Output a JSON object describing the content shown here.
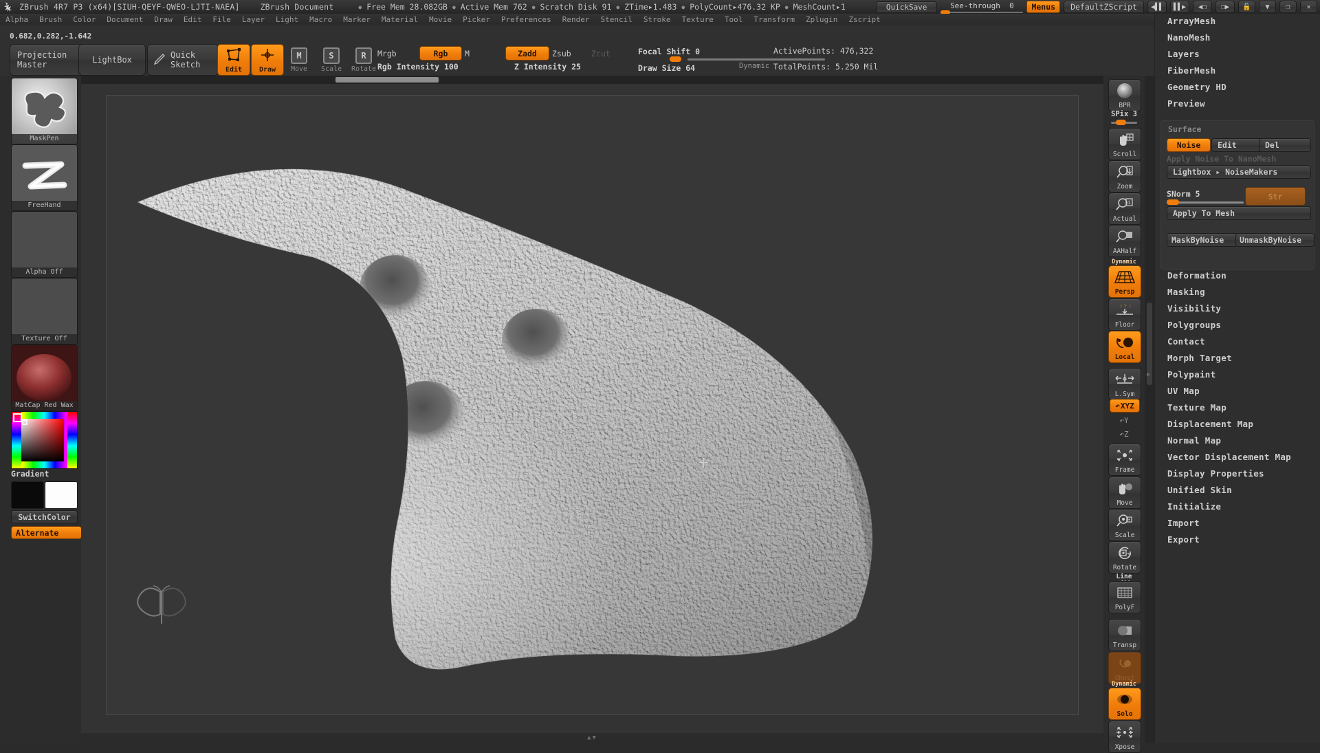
{
  "titlebar": {
    "app_title": "ZBrush 4R7 P3 (x64)[SIUH-QEYF-QWEO-LJTI-NAEA]",
    "document_title": "ZBrush Document",
    "stats": [
      "Free Mem 28.082GB",
      "Active Mem 762",
      "Scratch Disk 91",
      "ZTime▸1.483",
      "PolyCount▸476.32 KP",
      "MeshCount▸1"
    ],
    "quicksave": "QuickSave",
    "seethrough_label": "See-through",
    "seethrough_value": "0",
    "menus_button": "Menus",
    "zscript": "DefaultZScript",
    "icons": [
      "prev-script-icon",
      "next-script-icon",
      "prev-doc-icon",
      "next-doc-icon",
      "lock-icon",
      "minimize-icon",
      "restore-icon",
      "close-icon"
    ]
  },
  "menubar": {
    "items": [
      "Alpha",
      "Brush",
      "Color",
      "Document",
      "Draw",
      "Edit",
      "File",
      "Layer",
      "Light",
      "Macro",
      "Marker",
      "Material",
      "Movie",
      "Picker",
      "Preferences",
      "Render",
      "Stencil",
      "Stroke",
      "Texture",
      "Tool",
      "Transform",
      "Zplugin",
      "Zscript"
    ]
  },
  "toolbar": {
    "coords": "0.682,0.282,-1.642",
    "projection_master": "Projection\nMaster",
    "projection_master_l1": "Projection",
    "projection_master_l2": "Master",
    "lightbox": "LightBox",
    "quick_sketch_l1": "Quick",
    "quick_sketch_l2": "Sketch",
    "edit": "Edit",
    "draw": "Draw",
    "move": "Move",
    "scale": "Scale",
    "rotate": "Rotate",
    "move_key": "M",
    "scale_key": "S",
    "rotate_key": "R",
    "mrgb": "Mrgb",
    "rgb": "Rgb",
    "m": "M",
    "rgb_intensity": "Rgb Intensity 100",
    "zadd": "Zadd",
    "zsub": "Zsub",
    "zcut": "Zcut",
    "z_intensity": "Z Intensity 25",
    "focal_shift": "Focal Shift 0",
    "draw_size": "Draw Size 64",
    "dynamic": "Dynamic",
    "active_points": "ActivePoints: 476,322",
    "total_points": "TotalPoints: 5.250 Mil"
  },
  "left_shelf": {
    "brush_label": "MaskPen",
    "stroke_label": "FreeHand",
    "alpha_label": "Alpha Off",
    "texture_label": "Texture Off",
    "material_label": "MatCap Red Wax",
    "gradient_label": "Gradient",
    "switch_color": "SwitchColor",
    "alternate": "Alternate"
  },
  "right_toolbar": {
    "items": [
      {
        "label": "BPR",
        "icon": "bpr-render-icon",
        "active": false
      },
      {
        "label": "SPix 3",
        "icon": "spix-slider",
        "active": false
      },
      {
        "label": "Scroll",
        "icon": "scroll-hand-icon",
        "active": false
      },
      {
        "label": "Zoom",
        "icon": "zoom-magnifier-icon",
        "active": false
      },
      {
        "label": "Actual",
        "icon": "actual-size-icon",
        "active": false
      },
      {
        "label": "AAHalf",
        "icon": "aahalf-icon",
        "active": false
      },
      {
        "label": "Persp",
        "icon": "perspective-grid-icon",
        "active": true,
        "tag": "Dynamic"
      },
      {
        "label": "Floor",
        "icon": "floor-grid-icon",
        "active": false
      },
      {
        "label": "Local",
        "icon": "local-pivot-icon",
        "active": true
      },
      {
        "label": "L.Sym",
        "icon": "local-symmetry-icon",
        "active": false
      },
      {
        "label": "XYZ",
        "icon": "xyz-axis-icon",
        "active": true
      },
      {
        "label": "Y",
        "icon": "y-axis-icon",
        "active": false
      },
      {
        "label": "Z",
        "icon": "z-axis-icon",
        "active": false
      },
      {
        "label": "Frame",
        "icon": "frame-icon",
        "active": false
      },
      {
        "label": "Move",
        "icon": "move-hand-icon",
        "active": false
      },
      {
        "label": "Scale",
        "icon": "scale-icon",
        "active": false
      },
      {
        "label": "Rotate",
        "icon": "rotate-icon",
        "active": false
      },
      {
        "label": "PolyF",
        "icon": "polyframe-icon",
        "active": false,
        "tag": "Line Fill"
      },
      {
        "label": "Transp",
        "icon": "transparency-icon",
        "active": false
      },
      {
        "label": "Ghost",
        "icon": "ghost-icon",
        "active": false
      },
      {
        "label": "Solo",
        "icon": "solo-icon",
        "active": true,
        "tag": "Dynamic"
      },
      {
        "label": "Xpose",
        "icon": "xpose-icon",
        "active": false
      }
    ],
    "spix_label": "SPix 3"
  },
  "right_panel": {
    "top_items": [
      "ArrayMesh",
      "NanoMesh",
      "Layers",
      "FiberMesh",
      "Geometry HD",
      "Preview"
    ],
    "surface": {
      "title": "Surface",
      "noise": "Noise",
      "edit": "Edit",
      "del": "Del",
      "apply_noise_to_nanomesh": "Apply Noise To NanoMesh",
      "lightbox_noisemakers": "Lightbox ▸ NoiseMakers",
      "snorm": "SNorm 5",
      "strength": "Str",
      "apply_to_mesh": "Apply To Mesh",
      "mask_by_noise": "MaskByNoise",
      "unmask_by_noise": "UnmaskByNoise"
    },
    "bottom_items": [
      "Deformation",
      "Masking",
      "Visibility",
      "Polygroups",
      "Contact",
      "Morph Target",
      "Polypaint",
      "UV Map",
      "Texture Map",
      "Displacement Map",
      "Normal Map",
      "Vector Displacement Map",
      "Display Properties",
      "Unified Skin",
      "Initialize",
      "Import",
      "Export"
    ]
  },
  "colors": {
    "accent": "#f07d0a",
    "panel": "#2e2e2e",
    "canvas": "#373737",
    "text": "#c2c2c2"
  }
}
